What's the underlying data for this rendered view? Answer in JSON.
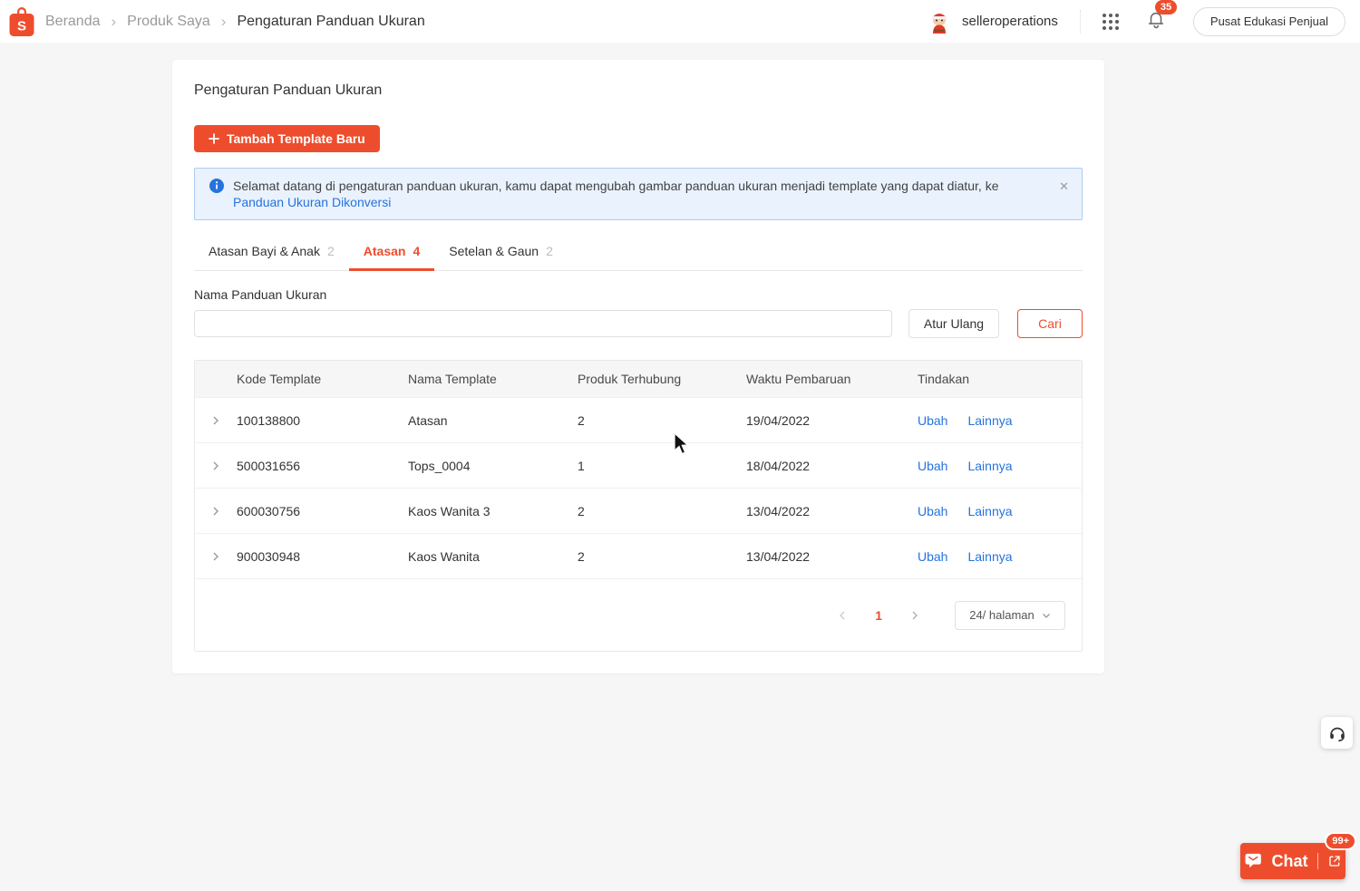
{
  "colors": {
    "accent_red": "#ee4d2d",
    "link_blue": "#2673dd",
    "banner_bg": "#e9f2fd",
    "banner_border": "#abccf3"
  },
  "icons": {
    "breadcrumb_separator": "›",
    "close_glyph": "✕"
  },
  "header": {
    "breadcrumb": [
      "Beranda",
      "Produk Saya",
      "Pengaturan Panduan Ukuran"
    ],
    "username": "selleroperations",
    "notification_count": "35",
    "education_button_label": "Pusat Edukasi Penjual"
  },
  "page": {
    "title": "Pengaturan Panduan Ukuran",
    "add_button_label": "Tambah Template Baru",
    "banner": {
      "text": "Selamat datang di pengaturan panduan ukuran, kamu dapat mengubah gambar panduan ukuran menjadi template yang dapat diatur, ke",
      "link_label": "Panduan Ukuran Dikonversi"
    },
    "tabs": [
      {
        "label": "Atasan Bayi & Anak",
        "count": "2"
      },
      {
        "label": "Atasan",
        "count": "4"
      },
      {
        "label": "Setelan & Gaun",
        "count": "2"
      }
    ],
    "search": {
      "label": "Nama Panduan Ukuran",
      "input_value": "",
      "reset_label": "Atur Ulang",
      "submit_label": "Cari"
    },
    "table": {
      "columns": [
        "Kode Template",
        "Nama Template",
        "Produk Terhubung",
        "Waktu Pembaruan",
        "Tindakan"
      ],
      "rows": [
        {
          "code": "100138800",
          "name": "Atasan",
          "linked_products": "2",
          "updated_at": "19/04/2022",
          "actions": [
            "Ubah",
            "Lainnya"
          ]
        },
        {
          "code": "500031656",
          "name": "Tops_0004",
          "linked_products": "1",
          "updated_at": "18/04/2022",
          "actions": [
            "Ubah",
            "Lainnya"
          ]
        },
        {
          "code": "600030756",
          "name": "Kaos Wanita 3",
          "linked_products": "2",
          "updated_at": "13/04/2022",
          "actions": [
            "Ubah",
            "Lainnya"
          ]
        },
        {
          "code": "900030948",
          "name": "Kaos Wanita",
          "linked_products": "2",
          "updated_at": "13/04/2022",
          "actions": [
            "Ubah",
            "Lainnya"
          ]
        }
      ]
    },
    "pagination": {
      "current_page": "1",
      "page_size_label": "24/ halaman"
    }
  },
  "chat": {
    "label": "Chat",
    "badge": "99+"
  }
}
